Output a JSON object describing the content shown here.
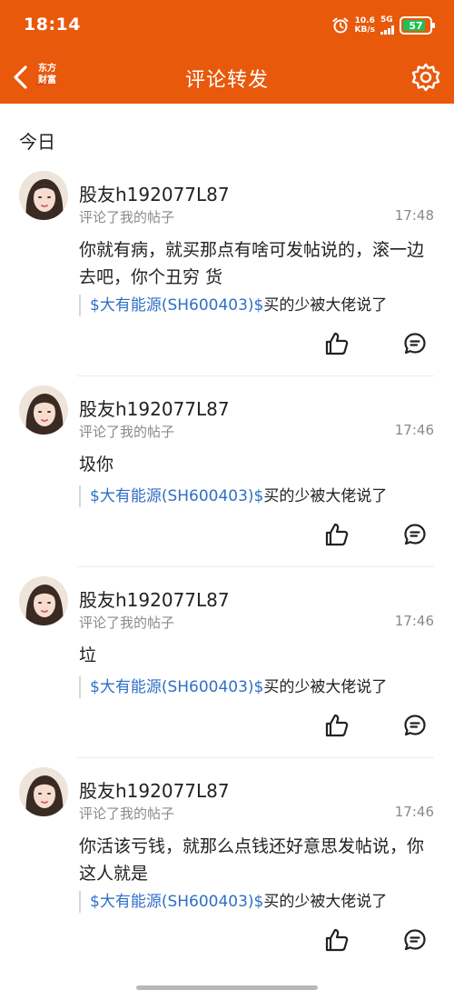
{
  "status_bar": {
    "time": "18:14",
    "speed_value": "10.6",
    "speed_unit": "KB/s",
    "network": "5G",
    "battery_level": "57"
  },
  "header": {
    "logo_line1": "东方",
    "logo_line2": "财富",
    "title": "评论转发",
    "settings_icon": "gear-icon"
  },
  "section_label": "今日",
  "comments": [
    {
      "username": "股友h192077L87",
      "action": "评论了我的帖子",
      "time": "17:48",
      "content": "你就有病，就买那点有啥可发帖说的，滚一边去吧，你个丑穷 货",
      "quote_stock": "$大有能源(SH600403)$",
      "quote_text": "买的少被大佬说了"
    },
    {
      "username": "股友h192077L87",
      "action": "评论了我的帖子",
      "time": "17:46",
      "content": "圾你",
      "quote_stock": "$大有能源(SH600403)$",
      "quote_text": "买的少被大佬说了"
    },
    {
      "username": "股友h192077L87",
      "action": "评论了我的帖子",
      "time": "17:46",
      "content": "垃",
      "quote_stock": "$大有能源(SH600403)$",
      "quote_text": "买的少被大佬说了"
    },
    {
      "username": "股友h192077L87",
      "action": "评论了我的帖子",
      "time": "17:46",
      "content": "你活该亏钱，就那么点钱还好意思发帖说，你这人就是",
      "quote_stock": "$大有能源(SH600403)$",
      "quote_text": "买的少被大佬说了"
    }
  ],
  "colors": {
    "brand": "#e8590c",
    "link": "#2f6fc6",
    "muted": "#8a8a8a",
    "battery": "#1fbf55"
  }
}
